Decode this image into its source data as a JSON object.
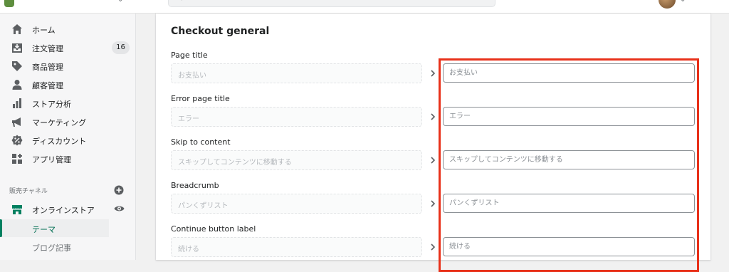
{
  "topbar": {
    "search_text": "ootn"
  },
  "sidebar": {
    "items": [
      {
        "label": "ホーム",
        "icon": "home-icon"
      },
      {
        "label": "注文管理",
        "icon": "orders-icon",
        "badge": "16"
      },
      {
        "label": "商品管理",
        "icon": "tag-icon"
      },
      {
        "label": "顧客管理",
        "icon": "person-icon"
      },
      {
        "label": "ストア分析",
        "icon": "analytics-icon"
      },
      {
        "label": "マーケティング",
        "icon": "megaphone-icon"
      },
      {
        "label": "ディスカウント",
        "icon": "discount-icon"
      },
      {
        "label": "アプリ管理",
        "icon": "apps-icon"
      }
    ],
    "sales_channel_label": "販売チャネル",
    "online_store": {
      "label": "オンラインストア",
      "icon": "store-icon"
    },
    "sub_items": [
      {
        "label": "テーマ",
        "active": true
      },
      {
        "label": "ブログ記事",
        "active": false
      }
    ]
  },
  "main": {
    "title": "Checkout general",
    "fields": [
      {
        "label": "Page title",
        "source": "お支払い",
        "target_placeholder": "お支払い"
      },
      {
        "label": "Error page title",
        "source": "エラー",
        "target_placeholder": "エラー"
      },
      {
        "label": "Skip to content",
        "source": "スキップしてコンテンツに移動する",
        "target_placeholder": "スキップしてコンテンツに移動する"
      },
      {
        "label": "Breadcrumb",
        "source": "パンくずリスト",
        "target_placeholder": "パンくずリスト"
      },
      {
        "label": "Continue button label",
        "source": "続ける",
        "target_placeholder": "続ける"
      }
    ]
  },
  "colors": {
    "accent": "#008060",
    "highlight": "#e8311a"
  }
}
